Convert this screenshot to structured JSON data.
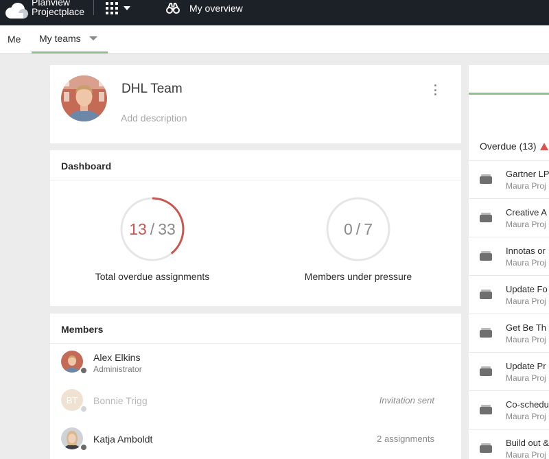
{
  "app": {
    "logo_line1": "Planview",
    "logo_line2": "Projectplace",
    "nav_title": "My overview"
  },
  "tabs": [
    {
      "label": "Me"
    },
    {
      "label": "My teams"
    }
  ],
  "team": {
    "name": "DHL Team",
    "description_placeholder": "Add description"
  },
  "dashboard": {
    "title": "Dashboard",
    "overdue": {
      "value": "13",
      "total": "33",
      "label": "Total overdue assignments",
      "fraction": 0.394
    },
    "pressure": {
      "value": "0",
      "total": "7",
      "label": "Members under pressure",
      "fraction": 0
    }
  },
  "members": {
    "title": "Members",
    "list": [
      {
        "name": "Alex Elkins",
        "role": "Administrator",
        "right": ""
      },
      {
        "name": "Bonnie Trigg",
        "initials": "BT",
        "role": "",
        "right": "Invitation sent"
      },
      {
        "name": "Katja Amboldt",
        "role": "",
        "right": "2 assignments"
      }
    ]
  },
  "right_panel": {
    "heading": "Overdue (13)",
    "tasks": [
      {
        "title": "Gartner LP",
        "sub": "Maura Proj"
      },
      {
        "title": "Creative A",
        "sub": "Maura Proj"
      },
      {
        "title": "Innotas or",
        "sub": "Maura Proj"
      },
      {
        "title": "Update Fo",
        "sub": "Maura Proj"
      },
      {
        "title": "Get Be Th",
        "sub": "Maura Proj"
      },
      {
        "title": "Update Pr",
        "sub": "Maura Proj"
      },
      {
        "title": "Co-schedu",
        "sub": "Maura Proj"
      },
      {
        "title": "Build out &",
        "sub": "Maura Proj"
      }
    ]
  },
  "colors": {
    "topbar": "#1c2027",
    "accent_green": "#8fbf8f",
    "overdue_red": "#c9564f"
  }
}
